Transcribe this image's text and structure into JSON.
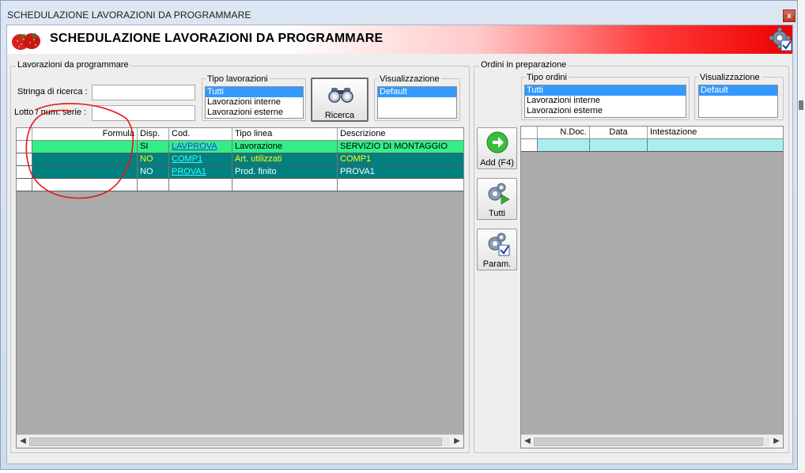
{
  "window": {
    "title": "SCHEDULAZIONE LAVORAZIONI DA PROGRAMMARE",
    "close_label": "x"
  },
  "header": {
    "title": "SCHEDULAZIONE LAVORAZIONI DA PROGRAMMARE",
    "logo_icon": "strawberry-icon",
    "settings_icon": "gear-check-icon"
  },
  "left_panel": {
    "group_title": "Lavorazioni da programmare",
    "search_label": "Stringa di ricerca :",
    "search_value": "",
    "lot_label": "Lotto / num. serie :",
    "lot_value": "",
    "tipo": {
      "title": "Tipo lavorazioni",
      "options": [
        "Tutti",
        "Lavorazioni interne",
        "Lavorazioni esterne"
      ],
      "selected": "Tutti"
    },
    "ricerca_button": {
      "label": "Ricerca",
      "icon": "binoculars-icon"
    },
    "visualizzazione": {
      "title": "Visualizzazione",
      "options": [
        "Default"
      ],
      "selected": "Default"
    },
    "grid": {
      "columns": [
        "",
        "Formula",
        "Disp.",
        "Cod.",
        "Tipo linea",
        "Descrizione"
      ],
      "rows": [
        {
          "formula": "",
          "disp": "SI",
          "cod": "LAVPROVA",
          "tipo_linea": "Lavorazione",
          "descrizione": "SERVIZIO DI MONTAGGIO",
          "bg": "#33ee88",
          "fg": "#000000",
          "link": "#1a3cff"
        },
        {
          "formula": "",
          "disp": "NO",
          "cod": "COMP1",
          "tipo_linea": "Art. utilizzati",
          "descrizione": "COMP1",
          "bg": "#008080",
          "fg": "#ffff00",
          "link": "#33ffff"
        },
        {
          "formula": "",
          "disp": "NO",
          "cod": "PROVA1",
          "tipo_linea": "Prod. finito",
          "descrizione": "PROVA1",
          "bg": "#008080",
          "fg": "#ffffff",
          "link": "#33ffff"
        },
        {
          "formula": "",
          "disp": "",
          "cod": "",
          "tipo_linea": "",
          "descrizione": "",
          "bg": "#ffffff",
          "fg": "#000000",
          "link": "#000000"
        }
      ]
    }
  },
  "right_panel": {
    "group_title": "Ordini in preparazione",
    "tipo": {
      "title": "Tipo ordini",
      "options": [
        "Tutti",
        "Lavorazioni interne",
        "Lavorazioni esterne"
      ],
      "selected": "Tutti"
    },
    "visualizzazione": {
      "title": "Visualizzazione",
      "options": [
        "Default"
      ],
      "selected": "Default"
    },
    "grid": {
      "columns": [
        "",
        "N.Doc.",
        "Data",
        "Intestazione"
      ],
      "rows": [
        {
          "ndoc": "",
          "data": "",
          "intestazione": "",
          "bg": "#aaeeee"
        }
      ]
    }
  },
  "side_buttons": [
    {
      "label": "Add (F4)",
      "icon": "green-arrow-right-icon"
    },
    {
      "label": "Tutti",
      "icon": "gears-play-icon"
    },
    {
      "label": "Param.",
      "icon": "gears-check-icon"
    }
  ],
  "colors": {
    "header_gradient_end": "#ee0000",
    "selection": "#3399ff",
    "grid_background": "#ababab",
    "annotation": "#e01818"
  }
}
